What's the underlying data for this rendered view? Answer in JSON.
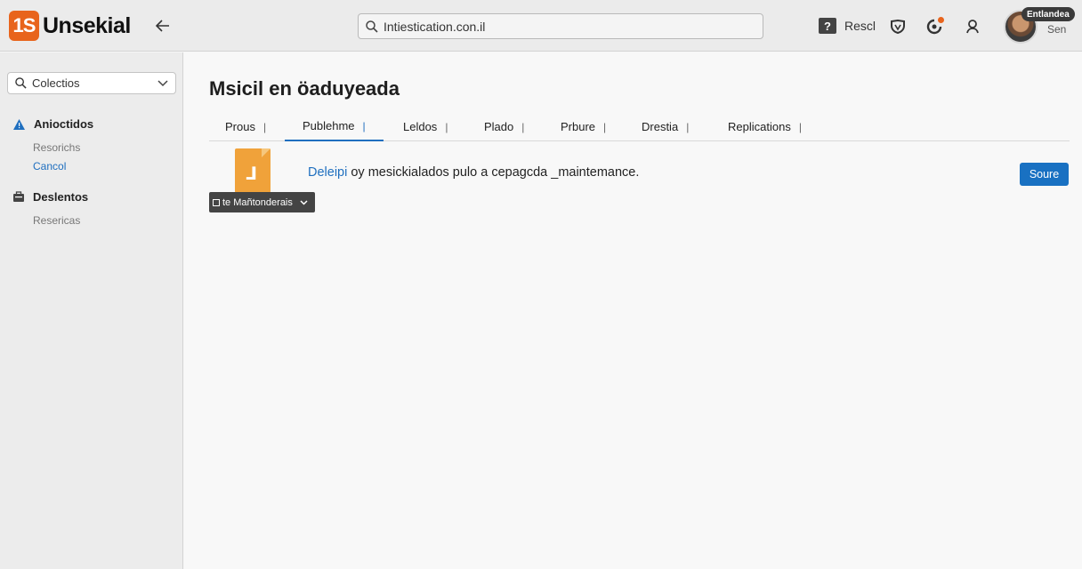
{
  "app": {
    "logo_mark": "1S",
    "logo_text": "Unsekial"
  },
  "search": {
    "value": "Intiestication.con.il"
  },
  "header": {
    "help_label": "Rescl",
    "user_badge": "Entlandea",
    "user_sub": "Sen"
  },
  "sidebar": {
    "collections_label": "Colectios",
    "sections": [
      {
        "label": "Anioctidos",
        "icon": "warning-icon",
        "links": [
          {
            "label": "Resorichs"
          },
          {
            "label": "Cancol"
          }
        ]
      },
      {
        "label": "Deslentos",
        "icon": "briefcase-icon",
        "links": [
          {
            "label": "Resericas"
          }
        ]
      }
    ]
  },
  "main": {
    "title": "Msicil en öaduyeada",
    "tabs": [
      {
        "label": "Prous"
      },
      {
        "label": "Publehme"
      },
      {
        "label": "Leldos"
      },
      {
        "label": "Plado"
      },
      {
        "label": "Prbure"
      },
      {
        "label": "Drestia"
      },
      {
        "label": "Replications"
      }
    ],
    "active_tab_index": 1,
    "item": {
      "dropdown_label": "te Mañtonderais",
      "notice_link": "Deleipi",
      "notice_text": " oy mesickialados pulo a cepagcda _maintemance.",
      "action_label": "Soure"
    }
  },
  "colors": {
    "accent": "#1f6fbf",
    "brand": "#e8641c",
    "folder": "#f0a23a"
  }
}
